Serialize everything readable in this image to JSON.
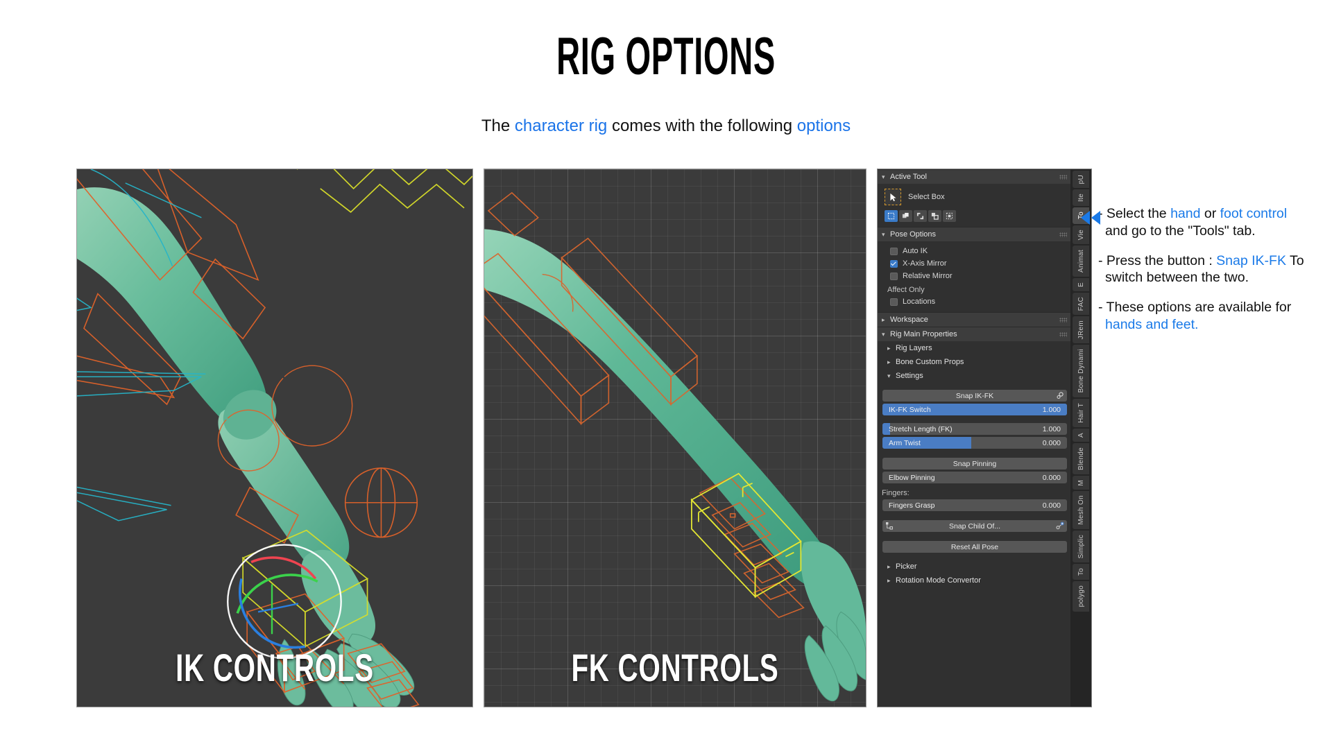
{
  "header": {
    "title": "RIG OPTIONS",
    "subtitle_parts": [
      {
        "text": "The ",
        "highlight": false
      },
      {
        "text": "character rig",
        "highlight": true
      },
      {
        "text": " comes with the following ",
        "highlight": false
      },
      {
        "text": "options",
        "highlight": true
      }
    ],
    "subtitle_plain": "The character rig comes with the following options"
  },
  "viewports": [
    {
      "id": "ik",
      "caption": "IK CONTROLS",
      "grid_visible": false,
      "background": "#3b3b3b"
    },
    {
      "id": "fk",
      "caption": "FK CONTROLS",
      "grid_visible": true,
      "background": "#3b3b3b"
    }
  ],
  "blender_panel": {
    "active_tool": {
      "header": "Active Tool",
      "tool_name": "Select Box",
      "select_modes": [
        "set-new",
        "extend",
        "subtract",
        "invert",
        "intersect"
      ],
      "active_mode_index": 0
    },
    "pose_options": {
      "header": "Pose Options",
      "checkboxes": [
        {
          "label": "Auto IK",
          "checked": false
        },
        {
          "label": "X-Axis Mirror",
          "checked": true
        },
        {
          "label": "Relative Mirror",
          "checked": false
        }
      ],
      "affect_only_label": "Affect Only",
      "affect_only": [
        {
          "label": "Locations",
          "checked": false
        }
      ]
    },
    "workspace": {
      "header": "Workspace",
      "expanded": false
    },
    "rig_main_properties": {
      "header": "Rig Main Properties",
      "expanded": true,
      "subsections": [
        {
          "label": "Rig Layers",
          "expanded": false
        },
        {
          "label": "Bone Custom Props",
          "expanded": false
        },
        {
          "label": "Settings",
          "expanded": true
        }
      ]
    },
    "settings_controls": {
      "snap_ik_fk_button": "Snap IK-FK",
      "sliders_group_1": [
        {
          "label": "IK-FK Switch",
          "value": "1.000",
          "fill_pct": 100
        },
        {
          "label": "Stretch Length (FK)",
          "value": "1.000",
          "fill_pct": 4
        },
        {
          "label": "Arm Twist",
          "value": "0.000",
          "fill_pct": 48
        }
      ],
      "snap_pinning_button": "Snap Pinning",
      "sliders_group_2": [
        {
          "label": "Elbow Pinning",
          "value": "0.000",
          "fill_pct": 0
        }
      ],
      "fingers_label": "Fingers:",
      "sliders_group_3": [
        {
          "label": "Fingers Grasp",
          "value": "0.000",
          "fill_pct": 0
        }
      ],
      "snap_child_of_button": "Snap Child Of...",
      "reset_all_pose_button": "Reset All Pose"
    },
    "footer_sections": [
      {
        "label": "Picker",
        "expanded": false
      },
      {
        "label": "Rotation Mode Convertor",
        "expanded": false
      }
    ],
    "vertical_tabs": [
      {
        "label": "pU",
        "active": false
      },
      {
        "label": "Ite",
        "active": false
      },
      {
        "label": "To",
        "active": true
      },
      {
        "label": "Vie",
        "active": false
      },
      {
        "label": "Animat",
        "active": false
      },
      {
        "label": "E",
        "active": false
      },
      {
        "label": "FAC",
        "active": false
      },
      {
        "label": "JRem",
        "active": false
      },
      {
        "label": "Bone Dynami",
        "active": false
      },
      {
        "label": "Hair T",
        "active": false
      },
      {
        "label": "A",
        "active": false
      },
      {
        "label": "Blende",
        "active": false
      },
      {
        "label": "M",
        "active": false
      },
      {
        "label": "Mesh On",
        "active": false
      },
      {
        "label": "Simplic",
        "active": false
      },
      {
        "label": "To",
        "active": false
      },
      {
        "label": "polygo",
        "active": false
      }
    ],
    "colors": {
      "accent_blue": "#4a7dc4",
      "panel_bg": "#303030",
      "header_bg": "#3d3d3d",
      "widget_bg": "#545454",
      "orange_outline": "#d79a2b"
    }
  },
  "annotation": {
    "arrow_icon": "double-chevron-left-icon",
    "arrow_color": "#1a7ae8",
    "bullets": [
      [
        {
          "text": "- Select the ",
          "highlight": false
        },
        {
          "text": "hand",
          "highlight": true
        },
        {
          "text": " or ",
          "highlight": false
        },
        {
          "text": "foot control",
          "highlight": true
        },
        {
          "text": " and go to the \"Tools\" tab.",
          "highlight": false
        }
      ],
      [
        {
          "text": "- Press the button : ",
          "highlight": false
        },
        {
          "text": "Snap IK-FK",
          "highlight": true
        },
        {
          "text": " To switch between the two.",
          "highlight": false
        }
      ],
      [
        {
          "text": "- These options are available for ",
          "highlight": false
        },
        {
          "text": "hands and feet.",
          "highlight": true
        }
      ]
    ]
  }
}
